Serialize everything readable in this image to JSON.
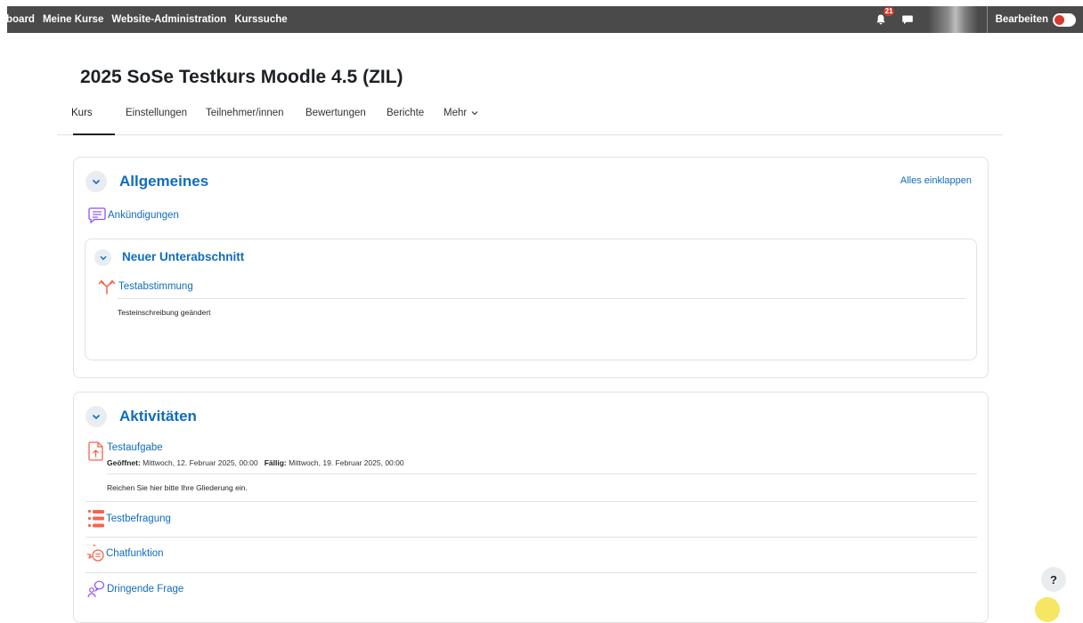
{
  "navbar": {
    "links": [
      "board",
      "Meine Kurse",
      "Website-Administration",
      "Kurssuche"
    ],
    "notification_count": "21",
    "edit_mode_label": "Bearbeiten",
    "edit_mode_on": false
  },
  "course": {
    "title": "2025 SoSe Testkurs Moodle 4.5 (ZIL)"
  },
  "tabs": [
    {
      "label": "Kurs",
      "active": true
    },
    {
      "label": "Einstellungen",
      "active": false
    },
    {
      "label": "Teilnehmer/innen",
      "active": false
    },
    {
      "label": "Bewertungen",
      "active": false
    },
    {
      "label": "Berichte",
      "active": false
    },
    {
      "label": "Mehr",
      "active": false
    }
  ],
  "section_general": {
    "title": "Allgemeines",
    "collapse_all": "Alles einklappen",
    "announcements": {
      "name": "Ankündigungen",
      "icon": "forum-icon"
    },
    "subsection": {
      "title": "Neuer Unterabschnitt",
      "activity": {
        "name": "Testabstimmung",
        "icon": "choice-icon"
      },
      "description": "Testeinschreibung geändert"
    }
  },
  "section_activities": {
    "title": "Aktivitäten",
    "items": [
      {
        "name": "Testaufgabe",
        "icon": "assignment-icon",
        "opened_label": "Geöffnet:",
        "opened_value": "Mittwoch, 12. Februar 2025, 00:00",
        "due_label": "Fällig:",
        "due_value": "Mittwoch, 19. Februar 2025, 00:00",
        "description": "Reichen Sie hier bitte Ihre Gliederung ein."
      },
      {
        "name": "Testbefragung",
        "icon": "feedback-icon"
      },
      {
        "name": "Chatfunktion",
        "icon": "chat-icon"
      },
      {
        "name": "Dringende Frage",
        "icon": "question-icon"
      }
    ]
  },
  "help_button": "?",
  "colors": {
    "navbar": "#4a4a4a",
    "link": "#0f6cbf",
    "toggle_knob": "#d63a2c",
    "forum_icon": "#8c52ff",
    "activity_icon": "#f7634d"
  }
}
